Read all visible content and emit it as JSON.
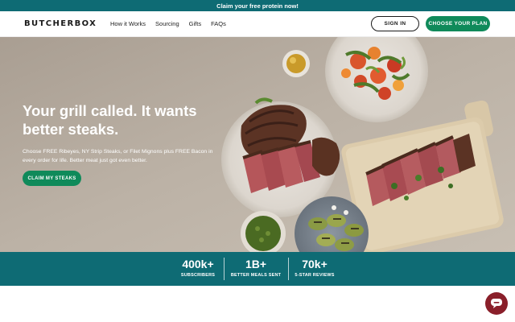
{
  "promo": {
    "text": "Claim your free protein now!"
  },
  "header": {
    "logo": "BUTCHERBOX",
    "nav": [
      "How it Works",
      "Sourcing",
      "Gifts",
      "FAQs"
    ],
    "sign_in": "SIGN IN",
    "choose_plan": "CHOOSE YOUR PLAN"
  },
  "hero": {
    "title": "Your grill called. It wants better steaks.",
    "subtitle": "Choose FREE Ribeyes, NY Strip Steaks, or Filet Mignons plus FREE Bacon in every order for life. Better meat just got even better.",
    "cta": "CLAIM MY STEAKS"
  },
  "stats": [
    {
      "value": "400k+",
      "label": "SUBSCRIBERS"
    },
    {
      "value": "1B+",
      "label": "BETTER MEALS SENT"
    },
    {
      "value": "70k+",
      "label": "5-STAR REVIEWS"
    }
  ],
  "colors": {
    "teal": "#0e6b74",
    "green": "#0f8a5a",
    "chat": "#8a1f2a"
  },
  "icons": {
    "chat": "chat-bubble-icon"
  }
}
